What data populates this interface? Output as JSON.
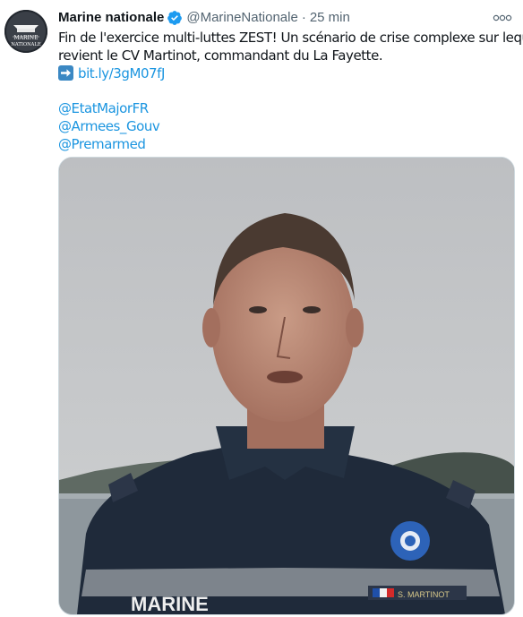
{
  "tweet": {
    "author_name": "Marine nationale",
    "handle": "@MarineNationale",
    "separator": "·",
    "time": "25 min",
    "more_label": "ooo",
    "avatar_text": [
      "MARINE",
      "NATIONALE"
    ],
    "text_lines": [
      "Fin de l'exercice multi-luttes ZEST! Un scénario de crise complexe sur lequel",
      "revient le CV Martinot, commandant du La Fayette."
    ],
    "link": "bit.ly/3gM07fJ",
    "mentions": [
      "@EtatMajorFR",
      "@Armees_Gouv",
      "@Premarmed"
    ]
  },
  "media": {
    "badge_left": "MARINE",
    "badge_right": "S. MARTINOT"
  },
  "colors": {
    "link": "#1b95e0",
    "verified": "#1d9bf0",
    "secondary_text": "#536471",
    "uniform": "#1f2a3a",
    "sky": "#c5c7c9"
  }
}
